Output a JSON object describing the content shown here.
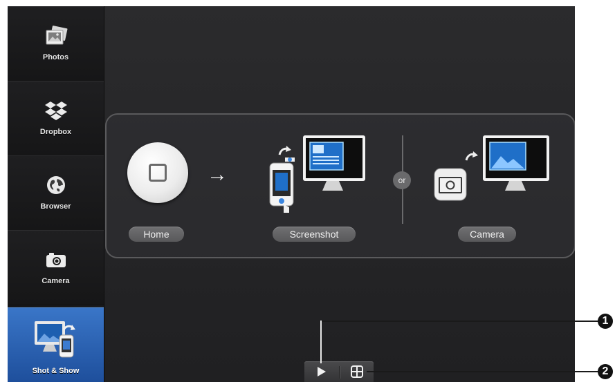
{
  "sidebar": {
    "items": [
      {
        "label": "Photos",
        "icon": "photos-icon"
      },
      {
        "label": "Dropbox",
        "icon": "dropbox-icon"
      },
      {
        "label": "Browser",
        "icon": "globe-icon"
      },
      {
        "label": "Camera",
        "icon": "camera-icon"
      },
      {
        "label": "Shot & Show",
        "icon": "shot-show-icon",
        "active": true
      }
    ]
  },
  "panel": {
    "home_label": "Home",
    "screenshot_label": "Screenshot",
    "camera_label": "Camera",
    "or_label": "or"
  },
  "toolbar": {
    "play_icon": "play-icon",
    "grid_icon": "grid-icon"
  },
  "callouts": [
    "1",
    "2"
  ],
  "colors": {
    "accent_blue": "#2f66b5",
    "background": "#252527",
    "pill": "#646466"
  }
}
